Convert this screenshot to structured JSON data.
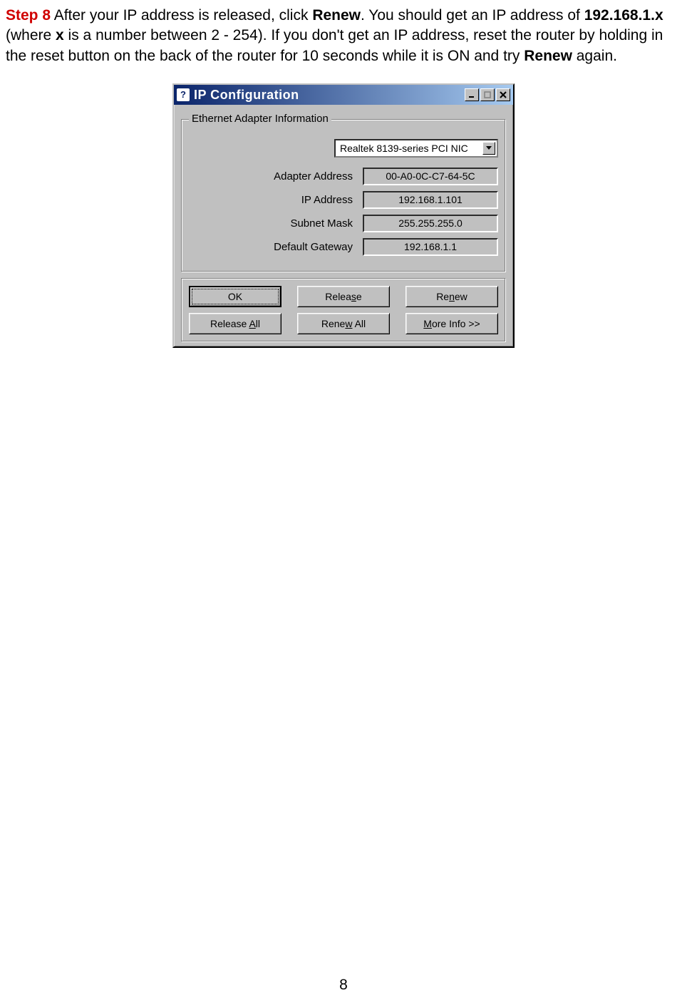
{
  "instruction": {
    "step_label": "Step 8",
    "text_1": " After your IP address is released, click ",
    "renew_1": "Renew",
    "text_2": ". You should get an IP address of ",
    "ip_pattern": "192.168.1.x",
    "text_3": " (where ",
    "x": "x",
    "text_4": " is a number between 2 - 254). If you don't get an IP address, reset the router by holding in the reset button on the back of the router for 10 seconds while it is ON and try ",
    "renew_2": "Renew",
    "text_5": " again."
  },
  "dialog": {
    "title": "IP Configuration",
    "icon_char": "?",
    "groupbox_title": "Ethernet Adapter Information",
    "adapter_selected": "Realtek 8139-series PCI NIC",
    "fields": {
      "adapter_address": {
        "label": "Adapter Address",
        "value": "00-A0-0C-C7-64-5C"
      },
      "ip_address": {
        "label": "IP Address",
        "value": "192.168.1.101"
      },
      "subnet_mask": {
        "label": "Subnet Mask",
        "value": "255.255.255.0"
      },
      "default_gateway": {
        "label": "Default Gateway",
        "value": "192.168.1.1"
      }
    },
    "buttons": {
      "ok": "OK",
      "release_pre": "Relea",
      "release_u": "s",
      "release_post": "e",
      "renew_pre": "Re",
      "renew_u": "n",
      "renew_post": "ew",
      "release_all_pre": "Release ",
      "release_all_u": "A",
      "release_all_post": "ll",
      "renew_all_pre": "Rene",
      "renew_all_u": "w",
      "renew_all_post": " All",
      "more_pre": "",
      "more_u": "M",
      "more_post": "ore Info >>"
    }
  },
  "page_number": "8"
}
